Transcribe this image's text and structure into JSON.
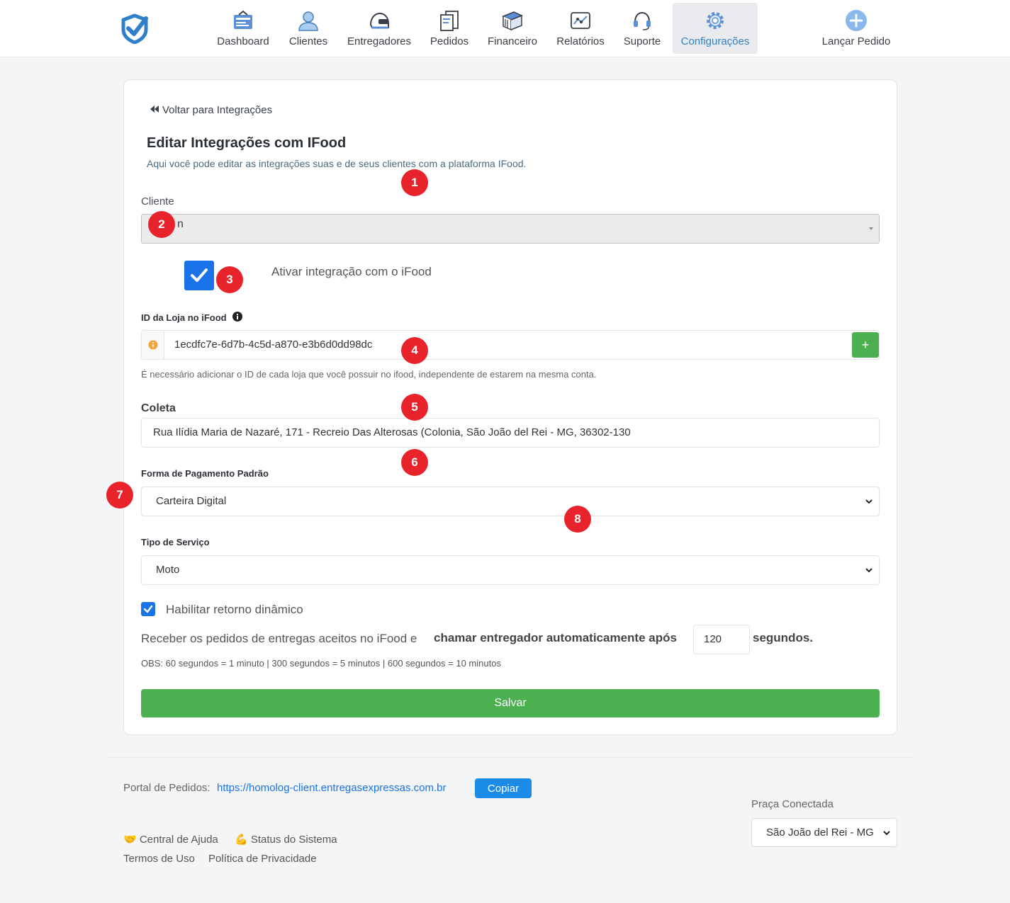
{
  "nav": {
    "items": [
      {
        "label": "Dashboard",
        "icon": "dashboard-icon"
      },
      {
        "label": "Clientes",
        "icon": "user-icon"
      },
      {
        "label": "Entregadores",
        "icon": "helmet-icon"
      },
      {
        "label": "Pedidos",
        "icon": "receipt-icon"
      },
      {
        "label": "Financeiro",
        "icon": "money-stack-icon"
      },
      {
        "label": "Relatórios",
        "icon": "chart-icon"
      },
      {
        "label": "Suporte",
        "icon": "headset-icon"
      },
      {
        "label": "Configurações",
        "icon": "gear-icon"
      }
    ],
    "active": "Configurações",
    "launch_label": "Lançar Pedido"
  },
  "card": {
    "back_link": "Voltar para Integrações",
    "title": "Editar Integrações com IFood",
    "subtitle": "Aqui você pode editar as integrações suas e de seus clientes com a plataforma IFood.",
    "cliente_label": "Cliente",
    "cliente_value": "n",
    "activate_label": "Ativar integração com o iFood",
    "activate_checked": true,
    "store_id_label": "ID da Loja no iFood",
    "store_id_value": "1ecdfc7e-6d7b-4c5d-a870-e3b6d0dd98dc",
    "add_button": "+",
    "store_id_help": "É necessário adicionar o ID de cada loja que você possuir no ifood, independente de estarem na mesma conta.",
    "coleta_label": "Coleta",
    "coleta_value": "Rua Ilídia Maria de Nazaré, 171 - Recreio Das Alterosas (Colonia, São João del Rei - MG, 36302-130",
    "payment_label": "Forma de Pagamento Padrão",
    "payment_value": "Carteira Digital",
    "service_label": "Tipo de Serviço",
    "service_value": "Moto",
    "dynamic_return_label": "Habilitar retorno dinâmico",
    "dynamic_return_checked": true,
    "receive_text": "Receber os pedidos de entregas aceitos no iFood e",
    "receive_bold": "chamar entregador automaticamente após",
    "seconds_value": "120",
    "seconds_label": "segundos.",
    "obs": "OBS: 60 segundos = 1 minuto | 300 segundos = 5 minutos | 600 segundos = 10 minutos",
    "save_button": "Salvar"
  },
  "markers": [
    "1",
    "2",
    "3",
    "4",
    "5",
    "6",
    "7",
    "8"
  ],
  "footer": {
    "portal_label": "Portal de Pedidos:",
    "portal_url": "https://homolog-client.entregasexpressas.com.br",
    "copy_button": "Copiar",
    "help_center": "🤝 Central de Ajuda",
    "system_status": "💪 Status do Sistema",
    "terms": "Termos de Uso",
    "privacy": "Política de Privacidade",
    "praca_label": "Praça Conectada",
    "praca_value": "São João del Rei - MG"
  },
  "colors": {
    "primary_blue": "#1a73e8",
    "success_green": "#4caf50",
    "marker_red": "#e8232b",
    "active_nav": "#2f80c8"
  }
}
